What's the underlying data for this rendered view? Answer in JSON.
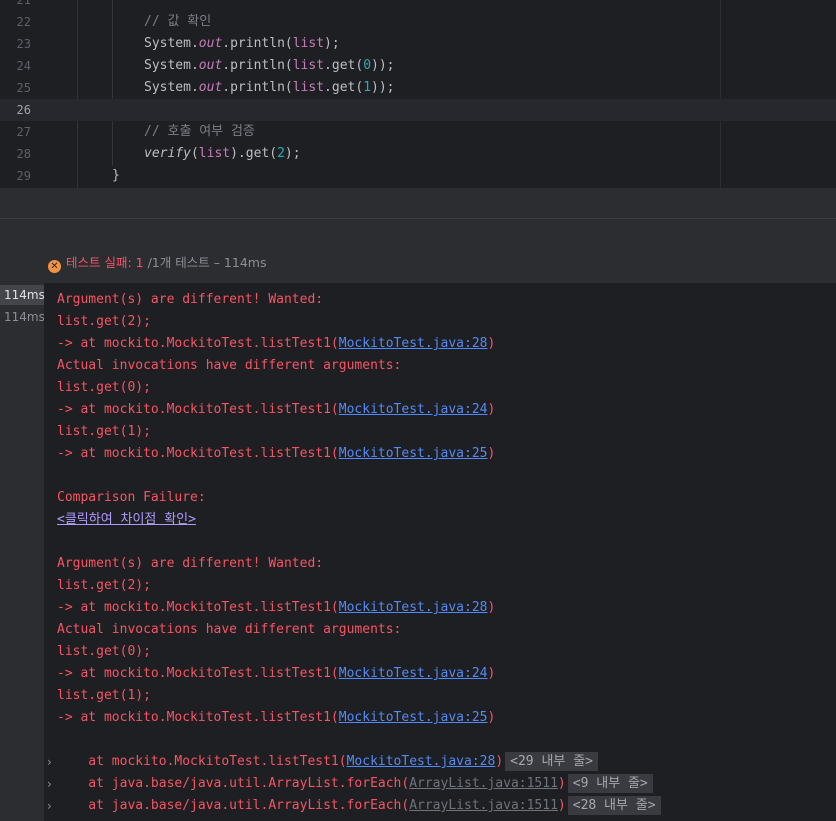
{
  "editor": {
    "top_partial_line": "21",
    "lines": [
      {
        "num": "22",
        "tokens": [
          {
            "t": "// 값 확인",
            "k": "comment"
          }
        ]
      },
      {
        "num": "23",
        "tokens": [
          {
            "t": "System.",
            "k": "plain"
          },
          {
            "t": "out",
            "k": "field"
          },
          {
            "t": ".println(",
            "k": "plain"
          },
          {
            "t": "list",
            "k": "var"
          },
          {
            "t": ");",
            "k": "plain"
          }
        ]
      },
      {
        "num": "24",
        "tokens": [
          {
            "t": "System.",
            "k": "plain"
          },
          {
            "t": "out",
            "k": "field"
          },
          {
            "t": ".println(",
            "k": "plain"
          },
          {
            "t": "list",
            "k": "var"
          },
          {
            "t": ".get(",
            "k": "plain"
          },
          {
            "t": "0",
            "k": "num"
          },
          {
            "t": "));",
            "k": "plain"
          }
        ]
      },
      {
        "num": "25",
        "tokens": [
          {
            "t": "System.",
            "k": "plain"
          },
          {
            "t": "out",
            "k": "field"
          },
          {
            "t": ".println(",
            "k": "plain"
          },
          {
            "t": "list",
            "k": "var"
          },
          {
            "t": ".get(",
            "k": "plain"
          },
          {
            "t": "1",
            "k": "num"
          },
          {
            "t": "));",
            "k": "plain"
          }
        ]
      },
      {
        "num": "26",
        "tokens": []
      },
      {
        "num": "27",
        "tokens": [
          {
            "t": "// 호출 여부 검증",
            "k": "comment"
          }
        ]
      },
      {
        "num": "28",
        "tokens": [
          {
            "t": "verify",
            "k": "ital"
          },
          {
            "t": "(",
            "k": "plain"
          },
          {
            "t": "list",
            "k": "var"
          },
          {
            "t": ").get(",
            "k": "plain"
          },
          {
            "t": "2",
            "k": "num"
          },
          {
            "t": ");",
            "k": "plain"
          }
        ]
      },
      {
        "num": "29",
        "tokens": [
          {
            "t": "}",
            "k": "plain"
          }
        ]
      }
    ]
  },
  "status": {
    "fail_label": "테스트 실패: 1",
    "rest_label": " /1개 테스트 – 114ms"
  },
  "sidebar": {
    "times": [
      "114ms",
      "114ms"
    ]
  },
  "console": {
    "block1": {
      "l1": "Argument(s) are different! Wanted:",
      "l2": "list.get(2);",
      "at_prefix": "-> at mockito.MockitoTest.listTest1(",
      "link28": "MockitoTest.java:28",
      "close": ")",
      "l4": "Actual invocations have different arguments:",
      "l5": "list.get(0);",
      "link24": "MockitoTest.java:24",
      "l7": "list.get(1);",
      "link25": "MockitoTest.java:25"
    },
    "comparison": "Comparison Failure:",
    "diff_link": "<클릭하여 차이점 확인>",
    "trace": [
      {
        "prefix": "    at mockito.MockitoTest.listTest1(",
        "link": "MockitoTest.java:28",
        "suffix": ")",
        "badge": "<29 내부 줄>"
      },
      {
        "prefix": "    at java.base/java.util.ArrayList.forEach(",
        "link": "ArrayList.java:1511",
        "suffix": ")",
        "badge": "<9 내부 줄>"
      },
      {
        "prefix": "    at java.base/java.util.ArrayList.forEach(",
        "link": "ArrayList.java:1511",
        "suffix": ")",
        "badge": "<28 내부 줄>"
      }
    ],
    "chevron": "›"
  }
}
